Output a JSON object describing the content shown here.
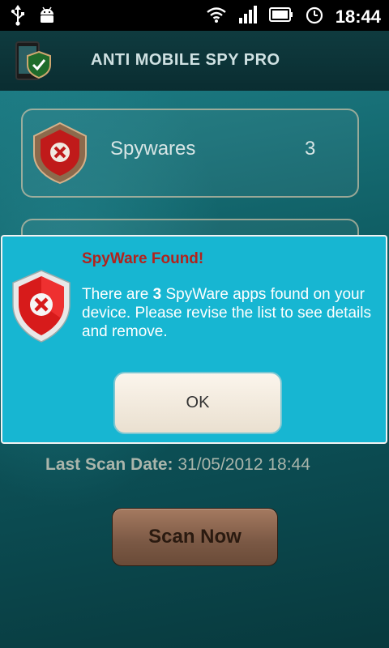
{
  "status_bar": {
    "time": "18:44",
    "icons_left": [
      "usb-icon",
      "android-debug-icon"
    ],
    "icons_right": [
      "wifi-icon",
      "signal-icon",
      "battery-icon",
      "alarm-clock-icon"
    ]
  },
  "app": {
    "title": "ANTI MOBILE SPY PRO",
    "logo_icon": "phone-shield-check-icon"
  },
  "cards": [
    {
      "label": "Spywares",
      "count": "3",
      "icon": "red-shield-x-icon"
    }
  ],
  "last_scan": {
    "label": "Last Scan Date:",
    "value": "31/05/2012 18:44"
  },
  "scan_button": {
    "label": "Scan Now"
  },
  "dialog": {
    "title": "SpyWare Found!",
    "message_prefix": "There are ",
    "count": "3",
    "message_suffix": " SpyWare apps found on your device. Please revise the list to see details and remove.",
    "ok_label": "OK",
    "icon": "red-shield-x-icon"
  },
  "colors": {
    "dialog_bg": "#17b6d2",
    "dialog_title": "#b3221c",
    "app_bg": "#0c4a4c"
  }
}
